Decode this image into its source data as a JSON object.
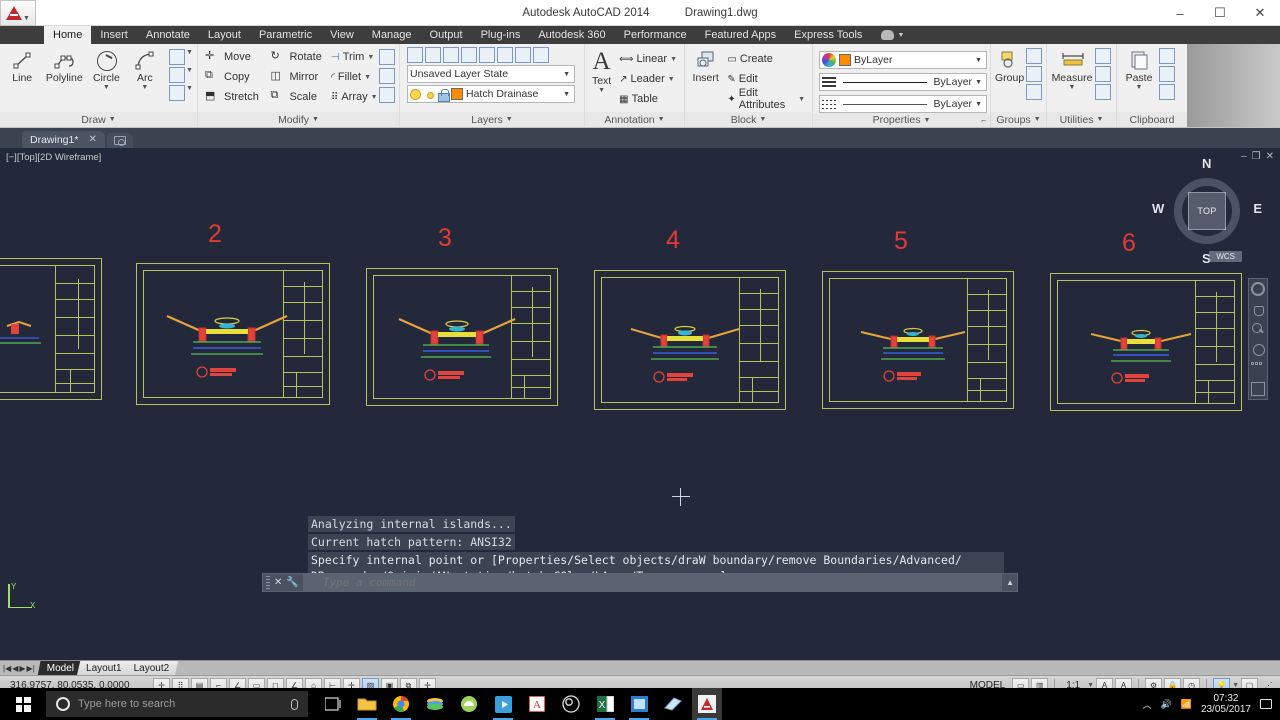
{
  "titlebar": {
    "app_name": "Autodesk AutoCAD 2014",
    "document": "Drawing1.dwg",
    "minimize": "–",
    "maximize": "☐",
    "close": "✕"
  },
  "ribbon_tabs": [
    {
      "label": "Home",
      "active": true
    },
    {
      "label": "Insert",
      "active": false
    },
    {
      "label": "Annotate",
      "active": false
    },
    {
      "label": "Layout",
      "active": false
    },
    {
      "label": "Parametric",
      "active": false
    },
    {
      "label": "View",
      "active": false
    },
    {
      "label": "Manage",
      "active": false
    },
    {
      "label": "Output",
      "active": false
    },
    {
      "label": "Plug-ins",
      "active": false
    },
    {
      "label": "Autodesk 360",
      "active": false
    },
    {
      "label": "Performance",
      "active": false
    },
    {
      "label": "Featured Apps",
      "active": false
    },
    {
      "label": "Express Tools",
      "active": false
    }
  ],
  "panels": {
    "draw": {
      "title": "Draw",
      "line": "Line",
      "polyline": "Polyline",
      "circle": "Circle",
      "arc": "Arc"
    },
    "modify": {
      "title": "Modify",
      "move": "Move",
      "copy": "Copy",
      "stretch": "Stretch",
      "rotate": "Rotate",
      "mirror": "Mirror",
      "scale": "Scale",
      "trim": "Trim",
      "fillet": "Fillet",
      "array": "Array"
    },
    "layers": {
      "title": "Layers",
      "layer_state": "Unsaved Layer State",
      "current_layer": "Hatch Drainase",
      "layer_color": "#ff8c00"
    },
    "annotation": {
      "title": "Annotation",
      "text": "Text",
      "linear": "Linear",
      "leader": "Leader",
      "table": "Table"
    },
    "block": {
      "title": "Block",
      "insert": "Insert",
      "create": "Create",
      "edit": "Edit",
      "edit_attributes": "Edit Attributes"
    },
    "properties": {
      "title": "Properties",
      "color": "ByLayer",
      "linewidth": "ByLayer",
      "linetype": "ByLayer"
    },
    "groups": {
      "title": "Groups",
      "group": "Group"
    },
    "utilities": {
      "title": "Utilities",
      "measure": "Measure"
    },
    "clipboard": {
      "title": "Clipboard",
      "paste": "Paste"
    }
  },
  "document_tabs": {
    "active_tab": "Drawing1*",
    "close_glyph": "✕"
  },
  "viewport": {
    "label": "[−][Top][2D Wireframe]",
    "viewcube": {
      "north": "N",
      "south": "S",
      "east": "E",
      "west": "W",
      "face": "TOP"
    },
    "wcs_label": "WCS",
    "ucs_x": "X",
    "ucs_y": "Y",
    "drawing_numbers": [
      "2",
      "3",
      "4",
      "5",
      "6"
    ],
    "number_color": "#e23b35",
    "sheet_border_color": "#b7c45a",
    "background_color": "#23293a"
  },
  "command_window": {
    "history": [
      "Analyzing internal islands...",
      "Current hatch pattern:  ANSI32"
    ],
    "prompt_line1": "Specify internal point or [Properties/Select objects/draW boundary/remove Boundaries/Advanced/",
    "prompt_line2": "DRaw order/Origin/ANnotative/hatch COlor/LAyer/Transparency]:",
    "input_placeholder": "Type a command",
    "close_glyph": "✕"
  },
  "layout_tabs": {
    "model": "Model",
    "layout1": "Layout1",
    "layout2": "Layout2",
    "first": "|◀",
    "prev": "◀",
    "next": "▶",
    "last": "▶|"
  },
  "statusbar": {
    "coordinates": "316.9757, 80.0535, 0.0000",
    "space": "MODEL",
    "annotation_scale": "1:1",
    "toggles": [
      "infer-constraints",
      "snap-mode",
      "grid-display",
      "ortho-mode",
      "polar-tracking",
      "object-snap",
      "3d-object-snap",
      "object-snap-tracking",
      "allow-ucs",
      "dynamic-input",
      "line-weight",
      "transparency",
      "quick-properties",
      "selection-cycling"
    ]
  },
  "taskbar": {
    "search_placeholder": "Type here to search",
    "clock_time": "07:32",
    "clock_date": "23/05/2017",
    "apps": [
      "task-view",
      "file-explorer",
      "chrome",
      "bluestacks",
      "android-studio",
      "media-player",
      "adobe-reader",
      "obs-studio",
      "excel",
      "nitro-pdf",
      "sketchup",
      "autocad"
    ]
  }
}
